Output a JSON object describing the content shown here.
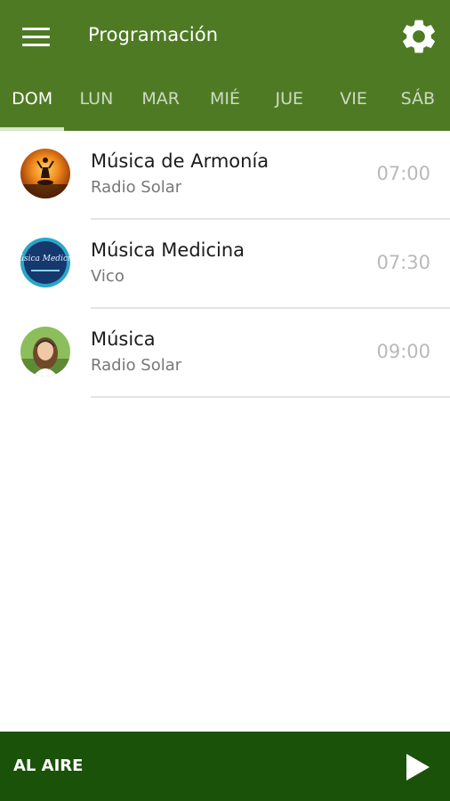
{
  "header": {
    "menu_icon": "hamburger-menu-icon",
    "title": "Programación",
    "settings_icon": "gear-icon",
    "background": "#4e7a24"
  },
  "tabs": [
    {
      "label": "DOM",
      "active": true
    },
    {
      "label": "LUN",
      "active": false
    },
    {
      "label": "MAR",
      "active": false
    },
    {
      "label": "MIÉ",
      "active": false
    },
    {
      "label": "JUE",
      "active": false
    },
    {
      "label": "VIE",
      "active": false
    },
    {
      "label": "SÁB",
      "active": false
    }
  ],
  "schedule": [
    {
      "title": "Música de Armonía",
      "host": "Radio Solar",
      "time": "07:00"
    },
    {
      "title": "Música Medicina",
      "host": "Vico",
      "time": "07:30",
      "avatar_text": "Música Medicina"
    },
    {
      "title": "Música",
      "host": "Radio Solar",
      "time": "09:00"
    }
  ],
  "player": {
    "label": "AL AIRE",
    "play_icon": "play-icon",
    "background": "#195208"
  }
}
